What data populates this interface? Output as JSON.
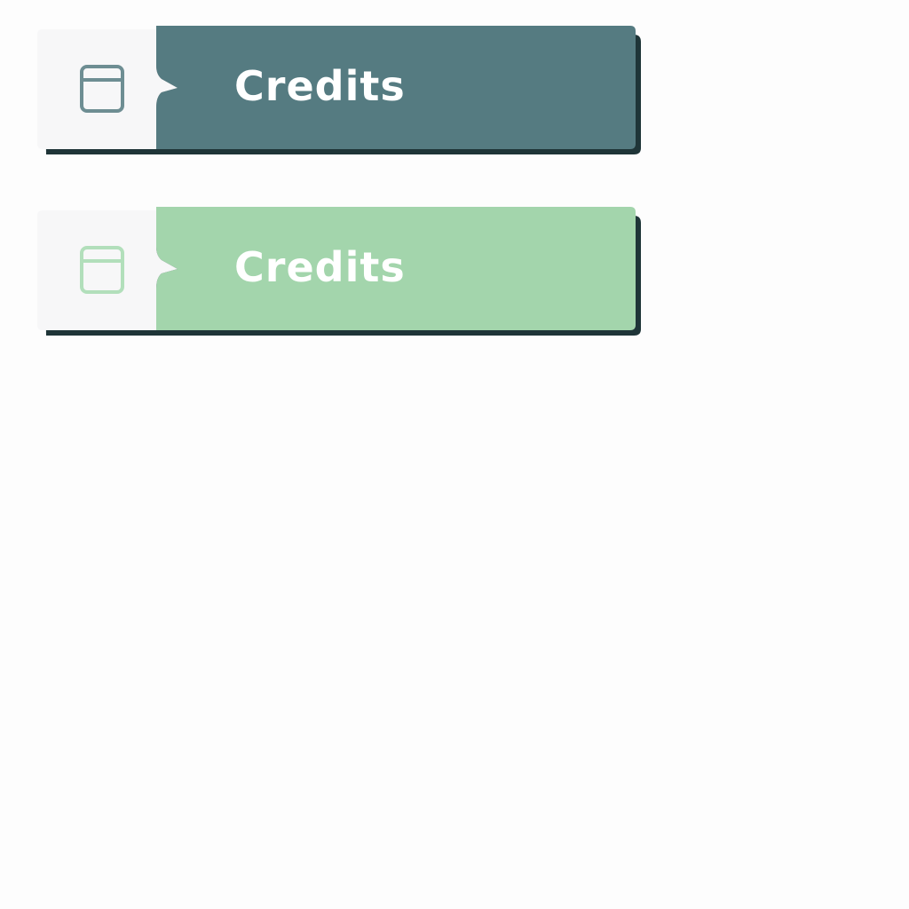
{
  "buttons": [
    {
      "state": "normal",
      "label": "Credits",
      "icon": "window-icon",
      "colors": {
        "tab": "#f7f7f8",
        "fill": "#557b81",
        "icon": "#6e8e93",
        "shadow": "#1f3538"
      }
    },
    {
      "state": "hover",
      "label": "Credits",
      "icon": "window-icon",
      "colors": {
        "tab": "#f7f7f8",
        "fill": "#a3d5ac",
        "icon": "#b2dfbb",
        "shadow": "#1f3538"
      }
    }
  ]
}
